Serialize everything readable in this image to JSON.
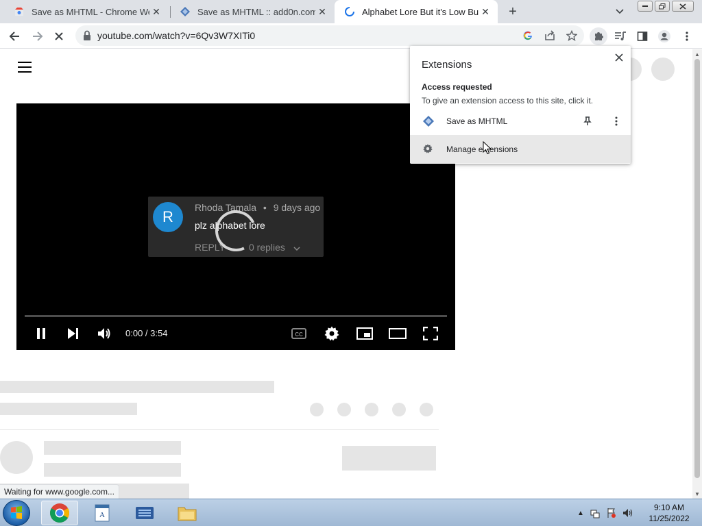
{
  "tabs": [
    {
      "title": "Save as MHTML - Chrome Web S",
      "active": false
    },
    {
      "title": "Save as MHTML :: add0n.com",
      "active": false
    },
    {
      "title": "Alphabet Lore But it's Low Budge",
      "active": true
    }
  ],
  "toolbar": {
    "url": "youtube.com/watch?v=6Qv3W7XITi0"
  },
  "video": {
    "comment_avatar_letter": "R",
    "comment_author": "Rhoda Tamala",
    "comment_separator": "•",
    "comment_age": "9 days ago",
    "comment_text": "plz alphabet lore",
    "reply_label": "REPLY",
    "replies_label": "0 replies",
    "timecode": "0:00 / 3:54",
    "cc_label": "CC"
  },
  "extensions_popup": {
    "title": "Extensions",
    "section_heading": "Access requested",
    "section_description": "To give an extension access to this site, click it.",
    "extension_name": "Save as MHTML",
    "manage_label": "Manage extensions"
  },
  "status": {
    "text": "Waiting for www.google.com..."
  },
  "taskbar": {
    "clock_time": "9:10 AM",
    "clock_date": "11/25/2022"
  }
}
